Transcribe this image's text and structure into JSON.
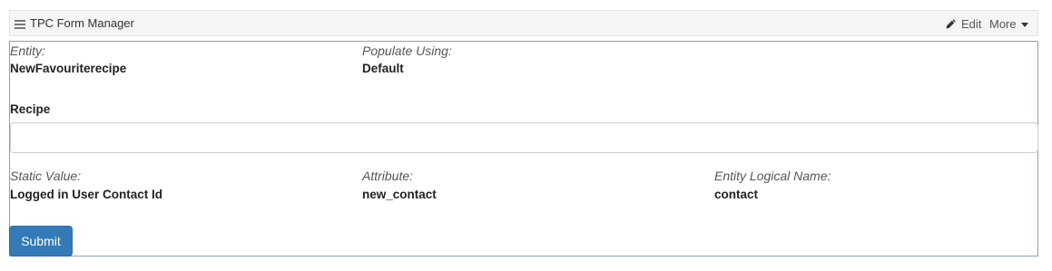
{
  "header": {
    "title": "TPC Form Manager",
    "edit_label": "Edit",
    "more_label": "More",
    "icons": {
      "menu": "hamburger-menu-icon",
      "edit": "pencil-icon",
      "more": "caret-down-icon"
    }
  },
  "form": {
    "entity": {
      "label": "Entity:",
      "value": "NewFavouriterecipe"
    },
    "populate_using": {
      "label": "Populate Using:",
      "value": "Default"
    },
    "recipe": {
      "label": "Recipe",
      "value": "",
      "placeholder": ""
    },
    "static_value": {
      "label": "Static Value:",
      "value": "Logged in User Contact Id"
    },
    "attribute": {
      "label": "Attribute:",
      "value": "new_contact"
    },
    "entity_logical_name": {
      "label": "Entity Logical Name:",
      "value": "contact"
    },
    "submit_label": "Submit"
  },
  "colors": {
    "primary_button": "#337ab7",
    "panel_border": "#8da2b5",
    "header_bg": "#f5f5f5"
  }
}
